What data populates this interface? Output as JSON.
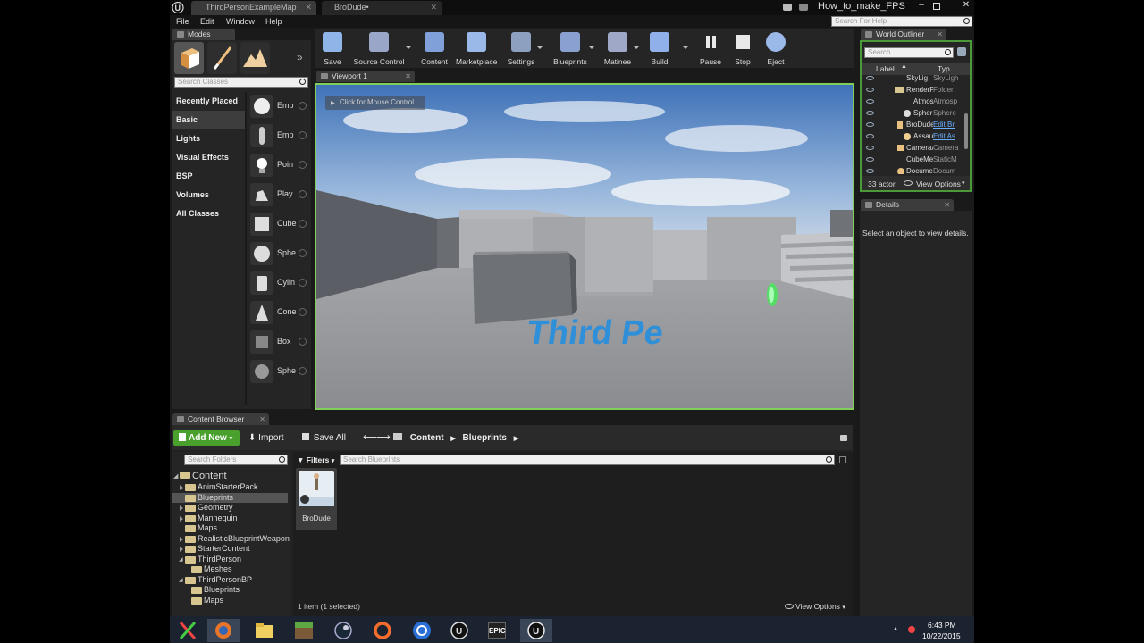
{
  "titlebar": {
    "tabs": [
      {
        "label": "ThirdPersonExampleMap"
      },
      {
        "label": "BroDude•"
      }
    ],
    "project_name": "How_to_make_FPS",
    "search_placeholder": "Search For Help"
  },
  "menu": [
    "File",
    "Edit",
    "Window",
    "Help"
  ],
  "modes": {
    "tab_label": "Modes",
    "search_placeholder": "Search Classes",
    "categories": [
      {
        "label": "Recently Placed",
        "selected": false
      },
      {
        "label": "Basic",
        "selected": true
      },
      {
        "label": "Lights",
        "selected": false
      },
      {
        "label": "Visual Effects",
        "selected": false
      },
      {
        "label": "BSP",
        "selected": false
      },
      {
        "label": "Volumes",
        "selected": false
      },
      {
        "label": "All Classes",
        "selected": false
      }
    ],
    "items": [
      {
        "label": "Emp",
        "icon": "sphere-icon"
      },
      {
        "label": "Emp",
        "icon": "mannequin-icon"
      },
      {
        "label": "Poin",
        "icon": "lightbulb-icon"
      },
      {
        "label": "Play",
        "icon": "player-start-icon"
      },
      {
        "label": "Cube",
        "icon": "cube-icon"
      },
      {
        "label": "Sphe",
        "icon": "sphere-icon"
      },
      {
        "label": "Cylin",
        "icon": "cylinder-icon"
      },
      {
        "label": "Cone",
        "icon": "cone-icon"
      },
      {
        "label": "Box",
        "icon": "box-trigger-icon"
      },
      {
        "label": "Sphe",
        "icon": "sphere-trigger-icon"
      }
    ]
  },
  "toolbar": {
    "buttons": [
      {
        "label": "Save",
        "icon": "save-icon",
        "color": "#8fb4e8"
      },
      {
        "label": "Source Control",
        "icon": "source-control-icon",
        "color": "#9aa6c8"
      },
      {
        "label": "Content",
        "icon": "content-icon",
        "color": "#7fa0d8"
      },
      {
        "label": "Marketplace",
        "icon": "marketplace-icon",
        "color": "#9ab8e8"
      },
      {
        "label": "Settings",
        "icon": "settings-icon",
        "color": "#8ea0c0"
      },
      {
        "label": "Blueprints",
        "icon": "blueprints-icon",
        "color": "#8aa0d0"
      },
      {
        "label": "Matinee",
        "icon": "matinee-icon",
        "color": "#a0a8c8"
      },
      {
        "label": "Build",
        "icon": "build-icon",
        "color": "#8fb0e8"
      },
      {
        "label": "Pause",
        "icon": "pause-icon",
        "color": "#e8e8e8"
      },
      {
        "label": "Stop",
        "icon": "stop-icon",
        "color": "#e8e8e8"
      },
      {
        "label": "Eject",
        "icon": "eject-icon",
        "color": "#9ab8e8"
      }
    ]
  },
  "viewport": {
    "tab_label": "Viewport 1",
    "overlay_hint": "Click for Mouse Control",
    "floor_text": "Third Pe"
  },
  "outliner": {
    "tab_label": "World Outliner",
    "search_placeholder": "Search...",
    "col_label": "Label",
    "col_type": "Typ",
    "rows": [
      {
        "label": "SkyLig",
        "type": "SkyLigh",
        "link": false
      },
      {
        "label": "RenderF",
        "type": "Folder",
        "link": false
      },
      {
        "label": "Atmos",
        "type": "Atmosp",
        "link": false
      },
      {
        "label": "Spher",
        "type": "Sphere",
        "link": false
      },
      {
        "label": "BroDude",
        "type": "Edit Br",
        "link": true
      },
      {
        "label": "Assau",
        "type": "Edit As",
        "link": true
      },
      {
        "label": "CameraA",
        "type": "Camera",
        "link": false
      },
      {
        "label": "CubeMe",
        "type": "StaticM",
        "link": false
      },
      {
        "label": "Docume",
        "type": "Docum",
        "link": false
      }
    ],
    "actor_count": "33 actor",
    "view_options": "View Options"
  },
  "details": {
    "tab_label": "Details",
    "empty_message": "Select an object to view details."
  },
  "content_browser": {
    "tab_label": "Content Browser",
    "add_new": "Add New",
    "import": "Import",
    "save_all": "Save All",
    "breadcrumb": [
      "Content",
      "Blueprints"
    ],
    "folder_search_placeholder": "Search Folders",
    "filters": "Filters",
    "asset_search_placeholder": "Search Blueprints",
    "tree": [
      {
        "label": "Content",
        "depth": 0,
        "expander": "expanded",
        "selected": false
      },
      {
        "label": "AnimStarterPack",
        "depth": 1,
        "expander": "collapsed",
        "selected": false
      },
      {
        "label": "Blueprints",
        "depth": 1,
        "expander": "none",
        "selected": true
      },
      {
        "label": "Geometry",
        "depth": 1,
        "expander": "collapsed",
        "selected": false
      },
      {
        "label": "Mannequin",
        "depth": 1,
        "expander": "collapsed",
        "selected": false
      },
      {
        "label": "Maps",
        "depth": 1,
        "expander": "none",
        "selected": false
      },
      {
        "label": "RealisticBlueprintWeapon",
        "depth": 1,
        "expander": "collapsed",
        "selected": false
      },
      {
        "label": "StarterContent",
        "depth": 1,
        "expander": "collapsed",
        "selected": false
      },
      {
        "label": "ThirdPerson",
        "depth": 1,
        "expander": "expanded",
        "selected": false
      },
      {
        "label": "Meshes",
        "depth": 2,
        "expander": "none",
        "selected": false
      },
      {
        "label": "ThirdPersonBP",
        "depth": 1,
        "expander": "expanded",
        "selected": false
      },
      {
        "label": "Blueprints",
        "depth": 2,
        "expander": "none",
        "selected": false
      },
      {
        "label": "Maps",
        "depth": 2,
        "expander": "none",
        "selected": false
      }
    ],
    "assets": [
      {
        "label": "BroDude"
      }
    ],
    "status": "1 item (1 selected)",
    "view_options": "View Options"
  },
  "taskbar": {
    "icons": [
      "x-app-icon",
      "firefox-icon",
      "file-explorer-icon",
      "minecraft-icon",
      "steam-icon",
      "origin-icon",
      "gog-icon",
      "unreal-icon",
      "epic-launcher-icon",
      "unreal-editor-icon"
    ],
    "epic_label": "EPIC",
    "time": "6:43 PM",
    "date": "10/22/2015"
  },
  "colors": {
    "accent_green": "#4aa02c",
    "viewport_border": "#7fcf5a",
    "link_blue": "#6ab0ff"
  }
}
